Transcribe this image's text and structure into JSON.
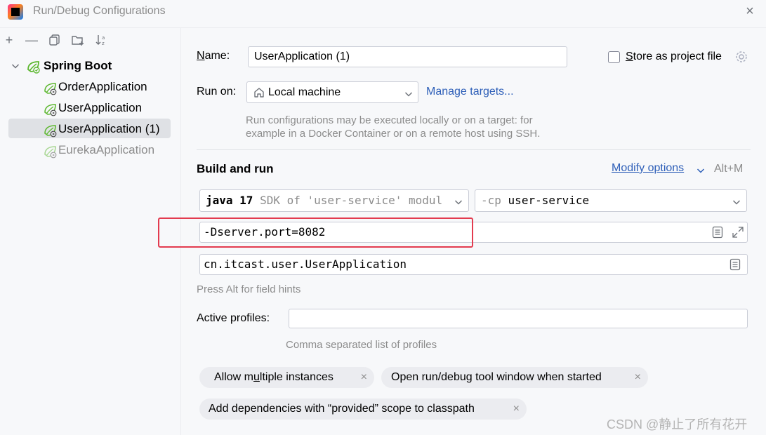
{
  "window": {
    "title": "Run/Debug Configurations"
  },
  "tree": {
    "group": "Spring Boot",
    "items": [
      {
        "label": "OrderApplication"
      },
      {
        "label": "UserApplication"
      },
      {
        "label": "UserApplication (1)"
      },
      {
        "label": "EurekaApplication"
      }
    ]
  },
  "form": {
    "name_label": "Name:",
    "name_value": "UserApplication (1)",
    "store_label": "Store as project file",
    "run_on_label": "Run on:",
    "run_on_value": "Local machine",
    "manage_targets": "Manage targets...",
    "run_on_hint_1": "Run configurations may be executed locally or on a target: for",
    "run_on_hint_2": "example in a Docker Container or on a remote host using SSH.",
    "build_run_heading": "Build and run",
    "modify_options": "Modify options",
    "modify_shortcut": "Alt+M",
    "jdk_bold": "java 17",
    "jdk_rest": "SDK of 'user-service' modul",
    "cp_flag": "-cp",
    "cp_value": "user-service",
    "vm_options": "-Dserver.port=8082",
    "main_class": "cn.itcast.user.UserApplication",
    "field_hint": "Press Alt for field hints",
    "active_profiles_label": "Active profiles:",
    "active_profiles_value": "",
    "profiles_hint": "Comma separated list of profiles"
  },
  "chips": [
    {
      "label": "Allow multiple instances"
    },
    {
      "label": "Open run/debug tool window when started"
    },
    {
      "label": "Add dependencies with “provided” scope to classpath"
    }
  ],
  "watermark": "CSDN @静止了所有花开",
  "colors": {
    "link": "#2e5fb8",
    "selection": "#dfe1e5",
    "highlight_box": "#e33b4f",
    "spring": "#5fb832"
  }
}
